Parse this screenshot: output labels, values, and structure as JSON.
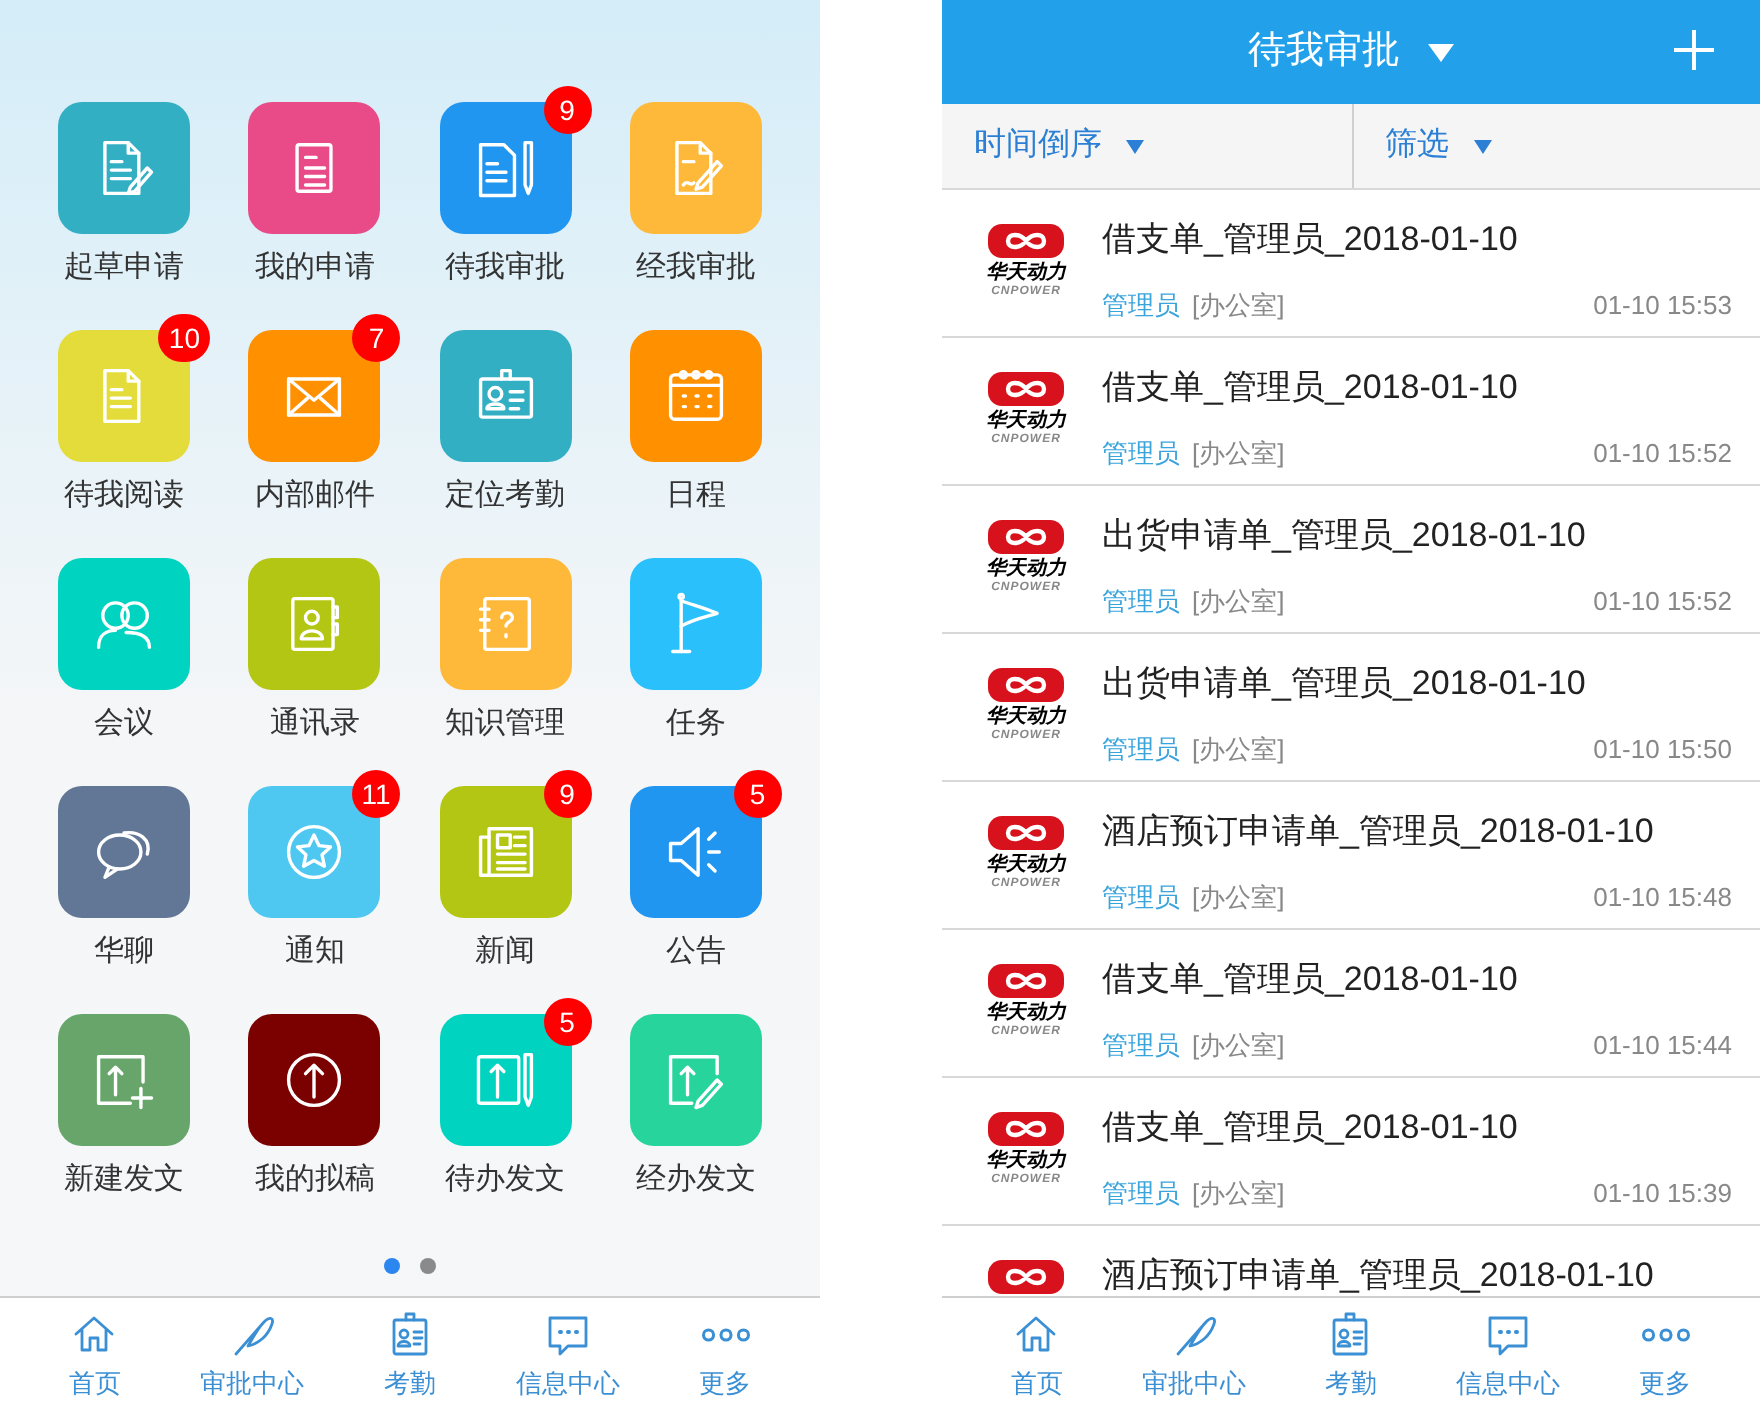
{
  "home_screen": {
    "apps": [
      {
        "label": "起草申请",
        "color": "#33afc4"
      },
      {
        "label": "我的申请",
        "color": "#e84b88"
      },
      {
        "label": "待我审批",
        "color": "#2196f0",
        "badge": "9"
      },
      {
        "label": "经我审批",
        "color": "#ffb93a"
      },
      {
        "label": "待我阅读",
        "color": "#e3dc3a",
        "badge": "10"
      },
      {
        "label": "内部邮件",
        "color": "#ff9000",
        "badge": "7"
      },
      {
        "label": "定位考勤",
        "color": "#33afc4"
      },
      {
        "label": "日程",
        "color": "#ff9000"
      },
      {
        "label": "会议",
        "color": "#00d4c0"
      },
      {
        "label": "通讯录",
        "color": "#b4c614"
      },
      {
        "label": "知识管理",
        "color": "#ffb93a"
      },
      {
        "label": "任务",
        "color": "#29c0fb"
      },
      {
        "label": "华聊",
        "color": "#627796"
      },
      {
        "label": "通知",
        "color": "#4fc8f1",
        "badge": "11"
      },
      {
        "label": "新闻",
        "color": "#b4c614",
        "badge": "9"
      },
      {
        "label": "公告",
        "color": "#2196f0",
        "badge": "5"
      },
      {
        "label": "新建发文",
        "color": "#67a56b"
      },
      {
        "label": "我的拟稿",
        "color": "#7b0000"
      },
      {
        "label": "待办发文",
        "color": "#00d4c0",
        "badge": "5"
      },
      {
        "label": "经办发文",
        "color": "#27d49c"
      }
    ],
    "page_dots": [
      {
        "selected": true
      },
      {
        "selected": false
      }
    ],
    "tab_bar": [
      {
        "label": "首页"
      },
      {
        "label": "审批中心"
      },
      {
        "label": "考勤"
      },
      {
        "label": "信息中心"
      },
      {
        "label": "更多"
      }
    ]
  },
  "approval_screen": {
    "title": "待我审批",
    "sort": "时间倒序",
    "filter": "筛选",
    "rows": [
      {
        "title": "借支单_管理员_2018-01-10",
        "logo": {
          "name": "华天动力",
          "sub": "CNPOWER"
        },
        "user": "管理员",
        "dept": "[办公室]",
        "time": "01-10 15:53"
      },
      {
        "title": "借支单_管理员_2018-01-10",
        "logo": {
          "name": "华天动力",
          "sub": "CNPOWER"
        },
        "user": "管理员",
        "dept": "[办公室]",
        "time": "01-10 15:52"
      },
      {
        "title": "出货申请单_管理员_2018-01-10",
        "logo": {
          "name": "华天动力",
          "sub": "CNPOWER"
        },
        "user": "管理员",
        "dept": "[办公室]",
        "time": "01-10 15:52"
      },
      {
        "title": "出货申请单_管理员_2018-01-10",
        "logo": {
          "name": "华天动力",
          "sub": "CNPOWER"
        },
        "user": "管理员",
        "dept": "[办公室]",
        "time": "01-10 15:50"
      },
      {
        "title": "酒店预订申请单_管理员_2018-01-10",
        "logo": {
          "name": "华天动力",
          "sub": "CNPOWER"
        },
        "user": "管理员",
        "dept": "[办公室]",
        "time": "01-10 15:48"
      },
      {
        "title": "借支单_管理员_2018-01-10",
        "logo": {
          "name": "华天动力",
          "sub": "CNPOWER"
        },
        "user": "管理员",
        "dept": "[办公室]",
        "time": "01-10 15:44"
      },
      {
        "title": "借支单_管理员_2018-01-10",
        "logo": {
          "name": "华天动力",
          "sub": "CNPOWER"
        },
        "user": "管理员",
        "dept": "[办公室]",
        "time": "01-10 15:39"
      },
      {
        "title": "酒店预订申请单_管理员_2018-01-10"
      }
    ],
    "tab_bar": [
      {
        "label": "首页"
      },
      {
        "label": "审批中心"
      },
      {
        "label": "考勤"
      },
      {
        "label": "信息中心"
      },
      {
        "label": "更多"
      }
    ]
  }
}
